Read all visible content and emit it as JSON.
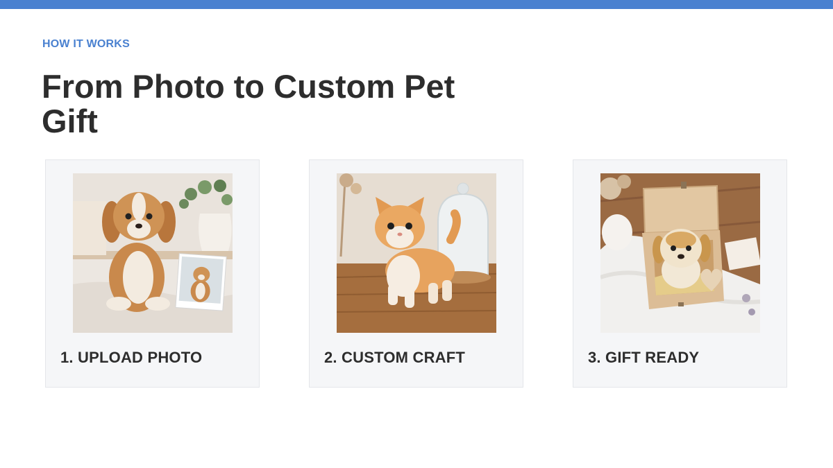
{
  "colors": {
    "accent": "#4a81d0",
    "heading": "#2d2d2d",
    "card_background": "#f5f6f8"
  },
  "section": {
    "eyebrow": "HOW IT WORKS",
    "title": "From Photo to Custom Pet Gift"
  },
  "steps": [
    {
      "label": "1. UPLOAD PHOTO",
      "image": "felted-dog-with-printed-photo"
    },
    {
      "label": "2. CUSTOM CRAFT",
      "image": "felted-orange-cat-on-wooden-table"
    },
    {
      "label": "3. GIFT READY",
      "image": "felted-puppy-in-wooden-gift-box"
    }
  ]
}
